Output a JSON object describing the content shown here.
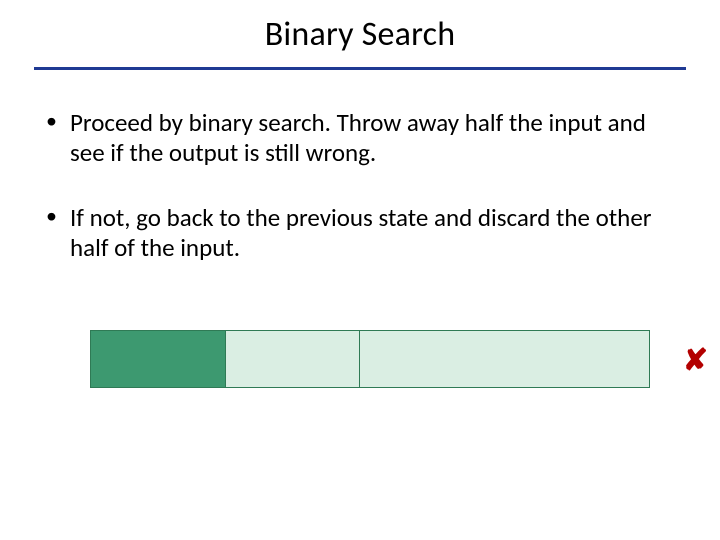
{
  "title": "Binary Search",
  "bullets": [
    "Proceed by binary search. Throw away half the input and see if the output is still wrong.",
    "If not, go back to the previous state and discard the other half of the input."
  ],
  "diagram": {
    "segments": [
      {
        "kind": "dark",
        "width_pct": 24
      },
      {
        "kind": "light",
        "width_pct": 24
      },
      {
        "kind": "light",
        "width_pct": 52
      }
    ],
    "result_mark": "✘"
  }
}
